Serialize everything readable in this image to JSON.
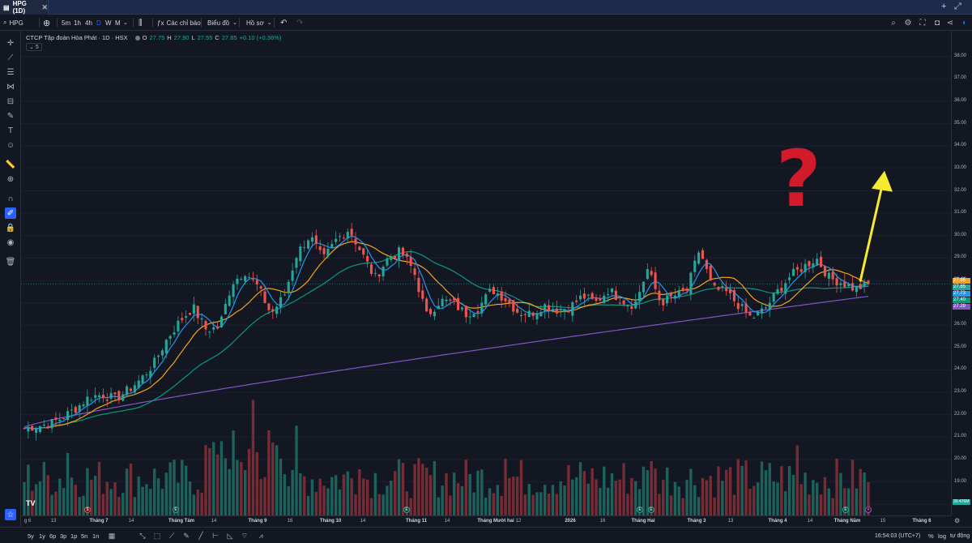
{
  "window": {
    "tab_title": "HPG (1D)"
  },
  "toolbar": {
    "symbol": "HPG",
    "timeframes": [
      "5m",
      "1h",
      "4h",
      "D",
      "W",
      "M"
    ],
    "active_timeframe": "D",
    "indicators_label": "Các chỉ báo",
    "chart_label": "Biểu đồ",
    "profile_label": "Hồ sơ"
  },
  "legend": {
    "name": "CTCP Tập đoàn Hòa Phát · 1D · HSX",
    "open_k": "O",
    "open_v": "27.75",
    "high_k": "H",
    "high_v": "27.90",
    "low_k": "L",
    "low_v": "27.55",
    "close_k": "C",
    "close_v": "27.85",
    "change": "+0.10 (+0.36%)",
    "ma_count": "5"
  },
  "price_axis": {
    "ticks": [
      "38.00",
      "37.00",
      "36.00",
      "35.00",
      "34.00",
      "33.00",
      "32.00",
      "31.00",
      "30.00",
      "29.00",
      "28.00",
      "27.00",
      "26.00",
      "25.00",
      "24.00",
      "23.00",
      "22.00",
      "21.00",
      "20.00",
      "19.00",
      "18.00"
    ],
    "labels": [
      {
        "text": "27.95",
        "color": "#f7a21b"
      },
      {
        "text": "27.85",
        "color": "#26a69a"
      },
      {
        "text": "27.73",
        "color": "#2196f3"
      },
      {
        "text": "27.40",
        "color": "#089981"
      },
      {
        "text": "27.29",
        "color": "#7e57c2"
      }
    ],
    "volume_label": "30.476M"
  },
  "time_axis": {
    "labels": [
      {
        "text": "g 6",
        "bold": false
      },
      {
        "text": "13",
        "bold": false
      },
      {
        "text": "Tháng 7",
        "bold": true
      },
      {
        "text": "14",
        "bold": false
      },
      {
        "text": "Tháng Tám",
        "bold": true
      },
      {
        "text": "14",
        "bold": false
      },
      {
        "text": "Tháng 9",
        "bold": true
      },
      {
        "text": "16",
        "bold": false
      },
      {
        "text": "Tháng 10",
        "bold": true
      },
      {
        "text": "14",
        "bold": false
      },
      {
        "text": "Tháng 11",
        "bold": true
      },
      {
        "text": "14",
        "bold": false
      },
      {
        "text": "Tháng Mười hai",
        "bold": true
      },
      {
        "text": "12",
        "bold": false
      },
      {
        "text": "2026",
        "bold": true
      },
      {
        "text": "16",
        "bold": false
      },
      {
        "text": "Tháng Hai",
        "bold": true
      },
      {
        "text": "Tháng 3",
        "bold": true
      },
      {
        "text": "13",
        "bold": false
      },
      {
        "text": "Tháng 4",
        "bold": true
      },
      {
        "text": "14",
        "bold": false
      },
      {
        "text": "Tháng Năm",
        "bold": true
      },
      {
        "text": "15",
        "bold": false
      },
      {
        "text": "Tháng 6",
        "bold": true
      }
    ]
  },
  "bottom": {
    "ranges": [
      "5y",
      "1y",
      "6p",
      "3p",
      "1p",
      "5n",
      "1n"
    ],
    "clock": "16:54:03 (UTC+7)",
    "percent": "%",
    "log": "log",
    "auto": "tự động"
  },
  "chart_data": {
    "type": "candlestick",
    "symbol": "HPG",
    "exchange": "HSX",
    "interval": "1D",
    "price_range": [
      17.5,
      38.5
    ],
    "last_price": 27.85,
    "series": [
      {
        "name": "MA",
        "color": "#2196f3"
      },
      {
        "name": "MA",
        "color": "#f7a21b"
      },
      {
        "name": "MA",
        "color": "#089981"
      },
      {
        "name": "MA",
        "color": "#7e57c2"
      }
    ],
    "approx_close_path": [
      21.4,
      21.5,
      21.6,
      21.9,
      22.3,
      22.8,
      22.9,
      22.7,
      23.1,
      23.6,
      24.3,
      25.4,
      26.2,
      26.8,
      25.8,
      25.9,
      27.9,
      28.4,
      27.7,
      26.5,
      27.3,
      29.2,
      30.0,
      28.9,
      29.8,
      30.3,
      29.2,
      28.1,
      29.0,
      29.3,
      28.4,
      26.4,
      27.1,
      27.0,
      26.5,
      26.8,
      27.6,
      27.2,
      26.6,
      26.5,
      26.9,
      26.7,
      26.8,
      27.3,
      27.0,
      27.6,
      27.1,
      26.9,
      28.5,
      27.0,
      27.3,
      27.5,
      29.4,
      27.6,
      27.5,
      26.9,
      26.3,
      26.7,
      27.5,
      28.2,
      28.6,
      29.0,
      28.1,
      27.9,
      27.6,
      27.85
    ],
    "annotations": [
      "?",
      "arrow-up"
    ]
  }
}
